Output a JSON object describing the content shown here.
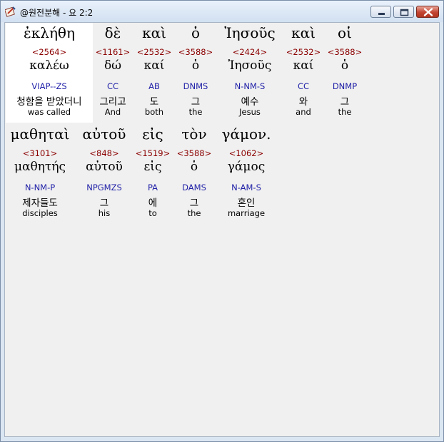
{
  "window": {
    "title": "@원전분해 - 요 2:2"
  },
  "verse": {
    "rows": [
      [
        {
          "greek": "ἐκλήθη",
          "strong": "<2564>",
          "lemma": "καλέω",
          "parsing": "VIAP--ZS",
          "korean": "청함을 받았더니",
          "english": "was called",
          "selected": true
        },
        {
          "greek": "δὲ",
          "strong": "<1161>",
          "lemma": "δώ",
          "parsing": "CC",
          "korean": "그리고",
          "english": "And"
        },
        {
          "greek": "καὶ",
          "strong": "<2532>",
          "lemma": "καί",
          "parsing": "AB",
          "korean": "도",
          "english": "both"
        },
        {
          "greek": "ὁ",
          "strong": "<3588>",
          "lemma": "ὁ",
          "parsing": "DNMS",
          "korean": "그",
          "english": "the"
        },
        {
          "greek": "Ἰησοῦς",
          "strong": "<2424>",
          "lemma": "Ἰησοῦς",
          "parsing": "N-NM-S",
          "korean": "예수",
          "english": "Jesus"
        },
        {
          "greek": "καὶ",
          "strong": "<2532>",
          "lemma": "καί",
          "parsing": "CC",
          "korean": "와",
          "english": "and"
        },
        {
          "greek": "οἱ",
          "strong": "<3588>",
          "lemma": "ὁ",
          "parsing": "DNMP",
          "korean": "그",
          "english": "the"
        }
      ],
      [
        {
          "greek": "μαθηταὶ",
          "strong": "<3101>",
          "lemma": "μαθητής",
          "parsing": "N-NM-P",
          "korean": "제자들도",
          "english": "disciples"
        },
        {
          "greek": "αὐτοῦ",
          "strong": "<848>",
          "lemma": "αὐτοῦ",
          "parsing": "NPGMZS",
          "korean": "그",
          "english": "his"
        },
        {
          "greek": "εἰς",
          "strong": "<1519>",
          "lemma": "εἰς",
          "parsing": "PA",
          "korean": "에",
          "english": "to"
        },
        {
          "greek": "τὸν",
          "strong": "<3588>",
          "lemma": "ὁ",
          "parsing": "DAMS",
          "korean": "그",
          "english": "the"
        },
        {
          "greek": "γάμον.",
          "strong": "<1062>",
          "lemma": "γάμος",
          "parsing": "N-AM-S",
          "korean": "혼인",
          "english": "marriage"
        }
      ]
    ]
  }
}
